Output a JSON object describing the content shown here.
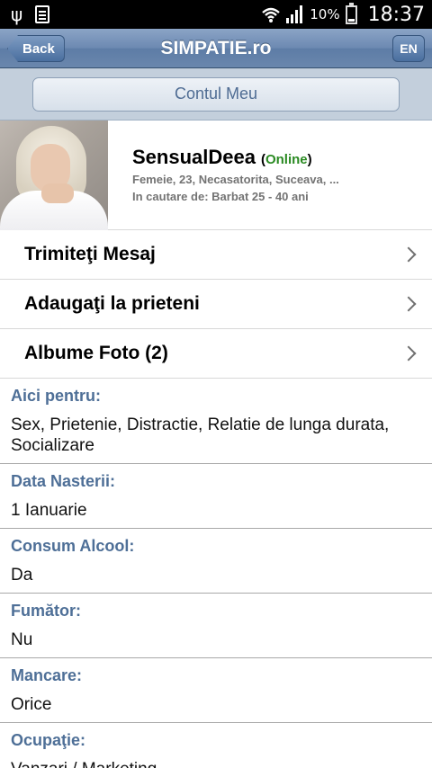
{
  "status_bar": {
    "icons": [
      "usb-icon",
      "document-icon",
      "wifi-icon",
      "signal-icon",
      "battery-icon"
    ],
    "battery": "10%",
    "time": "18:37"
  },
  "navbar": {
    "back_label": "Back",
    "title": "SIMPATIE.ro",
    "lang_label": "EN"
  },
  "account": {
    "button_label": "Contul Meu"
  },
  "profile": {
    "username": "SensualDeea",
    "status_open": "(",
    "status": "Online",
    "status_close": ")",
    "status_color": "#2a8a22",
    "details_line": "Femeie, 23, Necasatorita, Suceava, ...",
    "seeking_line": "In cautare de: Barbat 25 - 40 ani"
  },
  "actions": [
    {
      "label": "Trimiteţi Mesaj"
    },
    {
      "label": "Adaugaţi la prieteni"
    },
    {
      "label": "Albume Foto (2)"
    }
  ],
  "details": [
    {
      "label": "Aici pentru:",
      "value": "Sex, Prietenie, Distractie, Relatie de lunga durata, Socializare"
    },
    {
      "label": "Data Nasterii:",
      "value": "1 Ianuarie"
    },
    {
      "label": "Consum Alcool:",
      "value": "Da"
    },
    {
      "label": "Fumător:",
      "value": "Nu"
    },
    {
      "label": "Mancare:",
      "value": "Orice"
    },
    {
      "label": "Ocupaţie:",
      "value": "Vanzari / Marketing"
    }
  ],
  "colors": {
    "navbar": "#6c89b1",
    "detail_label": "#4e6f97",
    "account_bar": "#c3cfdc"
  }
}
